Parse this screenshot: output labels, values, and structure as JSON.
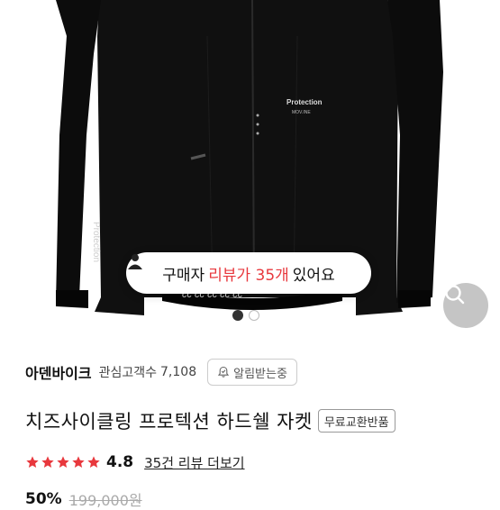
{
  "gallery": {
    "jacket_chest_text": "Protection",
    "jacket_chest_subtext": "MOV.INE",
    "jacket_sleeve_text": "Protection",
    "jacket_hem_text": "cc cc cc cc cc",
    "review_prompt_prefix": "구매자 ",
    "review_prompt_highlight": "리뷰가 35개",
    "review_prompt_suffix": " 있어요",
    "slide_current": 1,
    "slide_total": 2
  },
  "brand": {
    "name": "아덴바이크",
    "interest_label": "관심고객수",
    "interest_count": "7,108",
    "alarm_label": "알림받는중"
  },
  "product": {
    "title": "치즈사이클링 프로텍션 하드쉘 자켓",
    "badge": "무료교환반품"
  },
  "rating": {
    "value": "4.8",
    "stars": 5,
    "review_link": "35건 리뷰 더보기"
  },
  "price": {
    "discount": "50%",
    "original": "199,000원"
  },
  "colors": {
    "star": "#e8383d",
    "highlight": "#e8383d"
  }
}
